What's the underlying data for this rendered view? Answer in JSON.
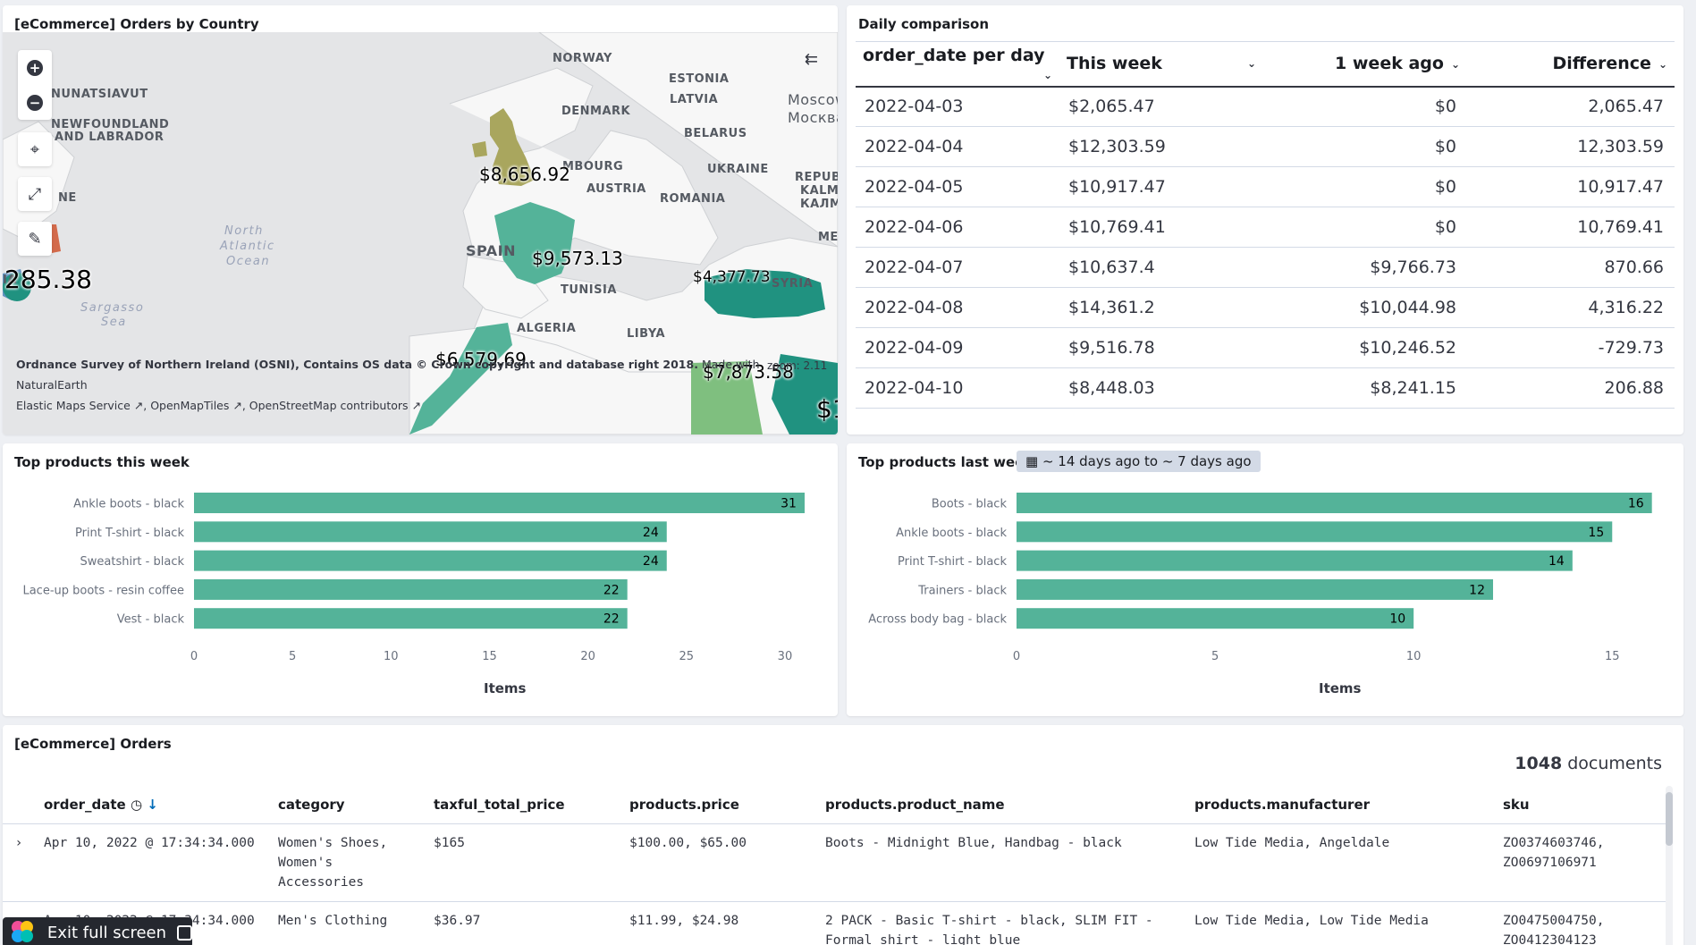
{
  "map_panel": {
    "title": "[eCommerce] Orders by Country",
    "zoom": "zoom: 2.11",
    "attribution_bold": "Ordnance Survey of Northern Ireland (OSNI), Contains OS data © Crown copyright and database right 2018.",
    "attribution_made": "Made with NaturalEarth",
    "attribution_line2": "Elastic Maps Service ↗, OpenMapTiles ↗, OpenStreetMap contributors ↗",
    "places": [
      "NORWAY",
      "ESTONIA",
      "LATVIA",
      "DENMARK",
      "BELARUS",
      "UKRAINE",
      "MBOURG",
      "AUSTRIA",
      "ROMANIA",
      "SPAIN",
      "TUNISIA",
      "ALGERIA",
      "LIBYA",
      "SYRIA",
      "NUNATSIAVUT",
      "NEWFOUNDLAND",
      "AND LABRADOR",
      "Moscow",
      "Москва",
      "REPUBL",
      "KALM",
      "КАЛМ",
      "ME",
      "NE",
      "IA"
    ],
    "oceans": [
      "North",
      "Atlantic",
      "Ocean",
      "Sargasso",
      "Sea"
    ],
    "values": [
      "$8,656.92",
      "$9,573.13",
      "$4,377.73",
      "$6,579.69",
      "$7,873.58",
      "285.38",
      "$1"
    ]
  },
  "daily": {
    "title": "Daily comparison",
    "headers": [
      "order_date per day",
      "This week",
      "1 week ago",
      "Difference"
    ],
    "rows": [
      [
        "2022-04-03",
        "$2,065.47",
        "$0",
        "2,065.47"
      ],
      [
        "2022-04-04",
        "$12,303.59",
        "$0",
        "12,303.59"
      ],
      [
        "2022-04-05",
        "$10,917.47",
        "$0",
        "10,917.47"
      ],
      [
        "2022-04-06",
        "$10,769.41",
        "$0",
        "10,769.41"
      ],
      [
        "2022-04-07",
        "$10,637.4",
        "$9,766.73",
        "870.66"
      ],
      [
        "2022-04-08",
        "$14,361.2",
        "$10,044.98",
        "4,316.22"
      ],
      [
        "2022-04-09",
        "$9,516.78",
        "$10,246.52",
        "-729.73"
      ],
      [
        "2022-04-10",
        "$8,448.03",
        "$8,241.15",
        "206.88"
      ]
    ]
  },
  "top_this": {
    "title": "Top products this week"
  },
  "top_last": {
    "title": "Top products last week",
    "date_range": "~ 14 days ago to ~ 7 days ago"
  },
  "chart_data": [
    {
      "type": "bar",
      "orientation": "horizontal",
      "title": "Top products this week",
      "categories": [
        "Ankle boots - black",
        "Print T-shirt - black",
        "Sweatshirt - black",
        "Lace-up boots - resin coffee",
        "Vest - black"
      ],
      "values": [
        31,
        24,
        24,
        22,
        22
      ],
      "xlabel": "Items",
      "ticks": [
        0,
        5,
        10,
        15,
        20,
        25,
        30
      ],
      "xlim": [
        0,
        31.5
      ],
      "color": "#54b399"
    },
    {
      "type": "bar",
      "orientation": "horizontal",
      "title": "Top products last week",
      "categories": [
        "Boots - black",
        "Ankle boots - black",
        "Print T-shirt - black",
        "Trainers - black",
        "Across body bag - black"
      ],
      "values": [
        16,
        15,
        14,
        12,
        10
      ],
      "xlabel": "Items",
      "ticks": [
        0,
        5,
        10,
        15
      ],
      "xlim": [
        0,
        16.3
      ],
      "color": "#54b399"
    }
  ],
  "orders": {
    "title": "[eCommerce] Orders",
    "doc_count": "1048",
    "doc_label": "documents",
    "columns": [
      "order_date",
      "category",
      "taxful_total_price",
      "products.price",
      "products.product_name",
      "products.manufacturer",
      "sku"
    ],
    "rows": [
      [
        "Apr 10, 2022 @ 17:34:34.000",
        "Women's Shoes, Women's Accessories",
        "$165",
        "$100.00, $65.00",
        "Boots - Midnight Blue, Handbag - black",
        "Low Tide Media, Angeldale",
        "ZO0374603746, ZO0697106971"
      ],
      [
        "Apr 10, 2022 @ 17:34:34.000",
        "Men's Clothing",
        "$36.97",
        "$11.99, $24.98",
        "2 PACK - Basic T-shirt - black, SLIM FIT - Formal shirt - light blue",
        "Low Tide Media, Low Tide Media",
        "ZO0475004750, ZO0412304123"
      ]
    ]
  },
  "exit_full_screen": "Exit full screen",
  "colors": {
    "accent": "#54b399",
    "positive": "#209280",
    "negative": "#e7664c",
    "map_green": "#54b399",
    "map_olive": "#a9a65e"
  }
}
